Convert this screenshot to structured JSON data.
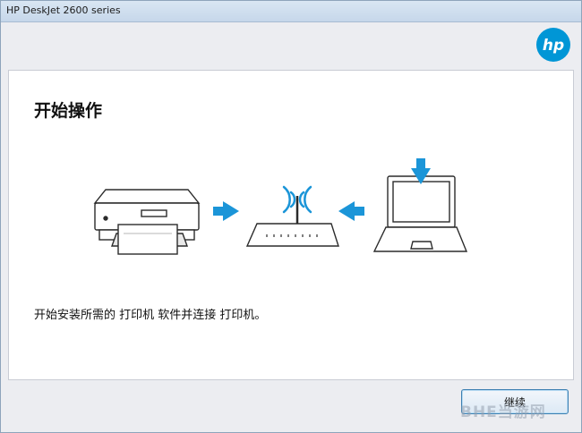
{
  "window": {
    "title": "HP DeskJet 2600 series"
  },
  "brand": {
    "logo_text": "hp",
    "color": "#0096d6"
  },
  "main": {
    "heading": "开始操作",
    "description": "开始安装所需的 打印机 软件并连接 打印机。"
  },
  "illustration": {
    "icons": [
      "printer-icon",
      "arrow-right-icon",
      "wireless-router-icon",
      "arrow-left-icon",
      "laptop-icon",
      "arrow-down-icon"
    ],
    "accent_color": "#1b95d8"
  },
  "footer": {
    "next_label": "继续"
  },
  "watermark": {
    "text": "BHE当游网"
  }
}
